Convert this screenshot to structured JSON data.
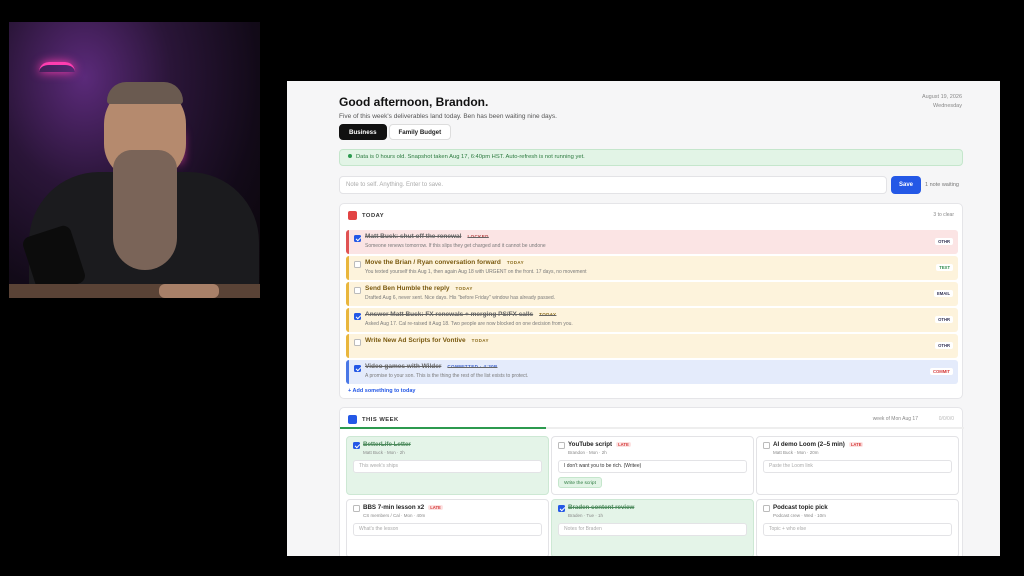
{
  "header": {
    "greeting": "Good afternoon, Brandon.",
    "subtitle": "Five of this week's deliverables land today. Ben has been waiting nine days.",
    "date_line1": "August 19, 2026",
    "date_line2": "Wednesday"
  },
  "tabs": [
    {
      "label": "Business",
      "active": true
    },
    {
      "label": "Family Budget",
      "active": false
    }
  ],
  "banner": {
    "text": "Data is 0 hours old. Snapshot taken Aug 17, 6:40pm HST. Auto-refresh is not running yet."
  },
  "note": {
    "placeholder": "Note to self. Anything. Enter to save.",
    "save_label": "Save",
    "waiting": "1 note waiting"
  },
  "today": {
    "title": "TODAY",
    "right": "3 to clear",
    "add_label": "+ Add something to today",
    "tasks": [
      {
        "title": "Matt Buck: shut off the renewal",
        "tag": "LOCKED",
        "desc": "Someone renews tomorrow. If this slips they get charged and it cannot be undone",
        "pill": "OTHR",
        "done": true,
        "tone": "red"
      },
      {
        "title": "Move the Brian / Ryan conversation forward",
        "tag": "TODAY",
        "desc": "You texted yourself this Aug 1, then again Aug 18 with URGENT on the front. 17 days, no movement",
        "pill": "TEXT",
        "done": false,
        "tone": "amber"
      },
      {
        "title": "Send Ben Humble the reply",
        "tag": "TODAY",
        "desc": "Drafted Aug 6, never sent. Nice days. His \"before Friday\" window has already passed.",
        "pill": "EMAIL",
        "done": false,
        "tone": "amber"
      },
      {
        "title": "Answer Matt Buck: FX renewals + merging PS/FX calls",
        "tag": "TODAY",
        "desc": "Asked Aug 17. Cal re-raised it Aug 18. Two people are now blocked on one decision from you.",
        "pill": "OTHR",
        "done": true,
        "tone": "amber"
      },
      {
        "title": "Write New Ad Scripts for Vontive",
        "tag": "TODAY",
        "desc": "",
        "pill": "OTHR",
        "done": false,
        "tone": "amber"
      },
      {
        "title": "Video games with Wilder",
        "tag": "COMMITTED · 4:30P",
        "desc": "A promise to your son. This is the thing the rest of the list exists to protect.",
        "pill": "COMMIT",
        "done": true,
        "tone": "blue"
      }
    ]
  },
  "week": {
    "title": "THIS WEEK",
    "right": "week of Mon Aug 17",
    "right2": "0/0/0/0",
    "progress": 0.33,
    "cards": [
      {
        "title": "BetterLife Letter",
        "late": "",
        "meta": "Matt Buck · Mon · 2h",
        "input": "This week's ships",
        "input_filled": false,
        "button": "",
        "done": true
      },
      {
        "title": "YouTube script",
        "late": "LATE",
        "meta": "Brandon · Mon · 2h",
        "input": "I don't want you to be rich. (Writee)",
        "input_filled": true,
        "button": "Write the script",
        "done": false
      },
      {
        "title": "AI demo Loom (2–5 min)",
        "late": "LATE",
        "meta": "Matt Buck · Mon · 20m",
        "input": "Paste the Loom link",
        "input_filled": false,
        "button": "",
        "done": false
      },
      {
        "title": "BBS 7-min lesson x2",
        "late": "LATE",
        "meta": "CS members / Cal · Mon · 40m",
        "input": "What's the lesson",
        "input_filled": false,
        "button": "",
        "done": false
      },
      {
        "title": "Braden content review",
        "late": "",
        "meta": "Braden · Tue · 1h",
        "input": "Notes for Braden",
        "input_filled": false,
        "button": "",
        "done": true
      },
      {
        "title": "Podcast topic pick",
        "late": "",
        "meta": "Podcast crew · Wed · 10m",
        "input": "Topic + who else",
        "input_filled": false,
        "button": "",
        "done": false
      }
    ]
  },
  "colors": {
    "accent": "#2458e6",
    "danger": "#e05252",
    "warning": "#e9b63c",
    "success": "#2c9a4f"
  }
}
